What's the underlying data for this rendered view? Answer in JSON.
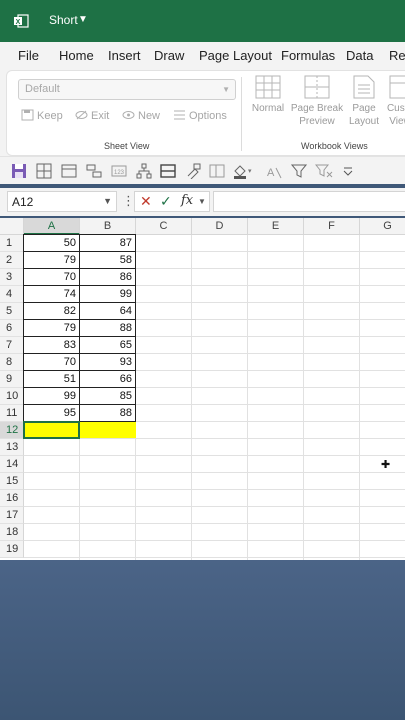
{
  "title_bar": {
    "title": "Short",
    "chevron": "chevron-down-icon",
    "bg": "#1e7145"
  },
  "menu": [
    "File",
    "Home",
    "Insert",
    "Draw",
    "Page Layout",
    "Formulas",
    "Data",
    "Rev"
  ],
  "sheet_view": {
    "dropdown_value": "Default",
    "buttons": [
      "Keep",
      "Exit",
      "New",
      "Options"
    ],
    "group_label": "Sheet View"
  },
  "workbook_views": {
    "buttons": [
      {
        "line1": "Normal",
        "line2": ""
      },
      {
        "line1": "Page Break",
        "line2": "Preview"
      },
      {
        "line1": "Page",
        "line2": "Layout"
      },
      {
        "line1": "Custo",
        "line2": "View"
      }
    ],
    "group_label": "Workbook Views"
  },
  "formula_bar": {
    "name_box": "A12",
    "dots": "⋮",
    "cancel": "✕",
    "enter": "✓",
    "fx": "fx",
    "formula": ""
  },
  "columns": [
    "A",
    "B",
    "C",
    "D",
    "E",
    "F",
    "G"
  ],
  "rows": [
    "1",
    "2",
    "3",
    "4",
    "5",
    "6",
    "7",
    "8",
    "9",
    "10",
    "11",
    "12",
    "13",
    "14",
    "15",
    "16",
    "17",
    "18",
    "19"
  ],
  "data": {
    "A": [
      "50",
      "79",
      "70",
      "74",
      "82",
      "79",
      "83",
      "70",
      "51",
      "99",
      "95"
    ],
    "B": [
      "87",
      "58",
      "86",
      "99",
      "64",
      "88",
      "65",
      "93",
      "66",
      "85",
      "88"
    ]
  },
  "selected_cell": "A12",
  "highlight_color": "#ffff00",
  "accent": "#1e7145"
}
